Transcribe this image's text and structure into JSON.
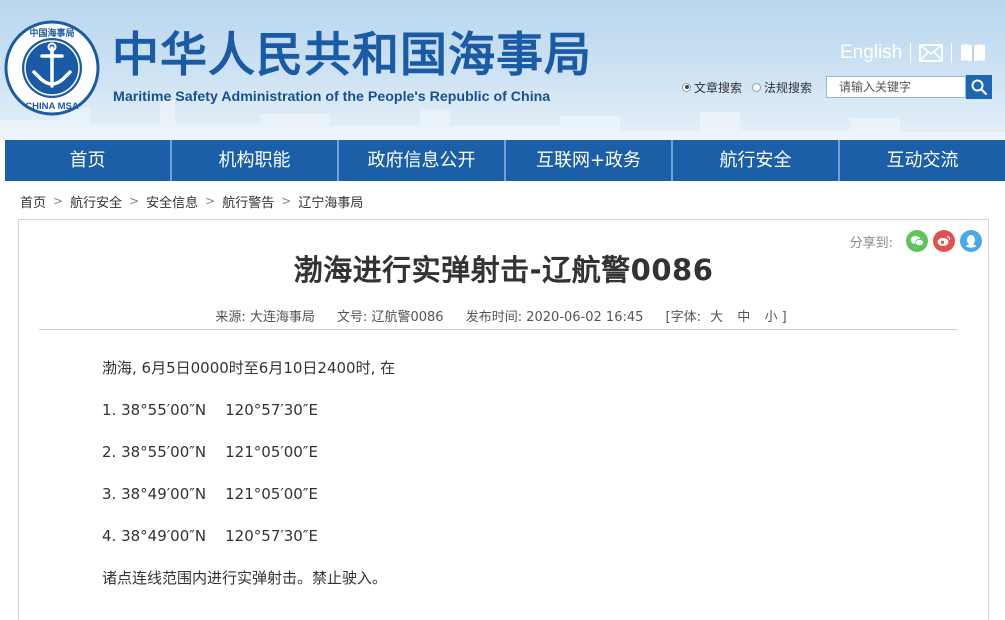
{
  "header": {
    "site_title": "中华人民共和国海事局",
    "site_subtitle": "Maritime Safety Administration of the People's Republic of China",
    "logo_text_cn": "中国海事局",
    "logo_text_en": "CHINA MSA",
    "english_link": "English",
    "search": {
      "radio_article": "文章搜索",
      "radio_law": "法规搜索",
      "placeholder": "请输入关键字"
    }
  },
  "nav": {
    "items": [
      "首页",
      "机构职能",
      "政府信息公开",
      "互联网+政务",
      "航行安全",
      "互动交流"
    ]
  },
  "breadcrumb": [
    "首页",
    "航行安全",
    "安全信息",
    "航行警告",
    "辽宁海事局"
  ],
  "article": {
    "share_label": "分享到:",
    "title": "渤海进行实弹射击-辽航警0086",
    "source": "来源: 大连海事局",
    "doc_no": "文号: 辽航警0086",
    "publish_time": "发布时间: 2020-06-02 16:45",
    "font_size_label": "[字体:",
    "font_size_large": "大",
    "font_size_medium": "中",
    "font_size_small": "小 ]",
    "paragraphs": [
      "渤海, 6月5日0000时至6月10日2400时, 在",
      "1. 38°55′00″N    120°57′30″E",
      "2. 38°55′00″N    121°05′00″E",
      "3. 38°49′00″N    121°05′00″E",
      "4. 38°49′00″N    120°57′30″E",
      "诸点连线范围内进行实弹射击。禁止驶入。"
    ]
  },
  "colors": {
    "brand_blue": "#1b5fa8",
    "title_blue": "#1a5aa6",
    "wechat_green": "#5fc35a",
    "weibo_red": "#e2504d",
    "qq_blue": "#49a8e8"
  },
  "icons": [
    "mail-icon",
    "book-icon",
    "search-icon",
    "wechat-icon",
    "weibo-icon",
    "qq-icon"
  ]
}
